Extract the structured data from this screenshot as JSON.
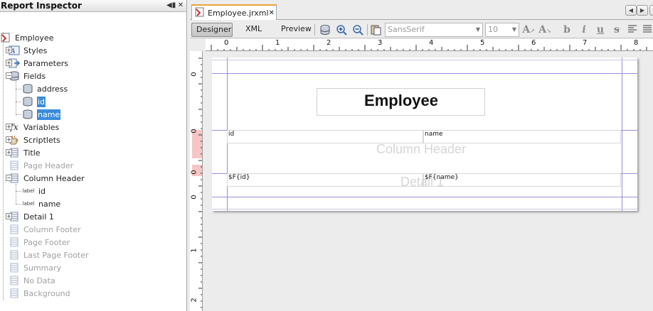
{
  "inspector": {
    "title": "Report Inspector",
    "tree": {
      "root": "Employee",
      "styles": "Styles",
      "parameters": "Parameters",
      "fields": "Fields",
      "field_items": [
        "address",
        "id",
        "name"
      ],
      "variables": "Variables",
      "scriptlets": "Scriptlets",
      "title": "Title",
      "page_header": "Page Header",
      "column_header": "Column Header",
      "column_header_items": [
        {
          "badge": "label",
          "name": "id"
        },
        {
          "badge": "label",
          "name": "name"
        }
      ],
      "detail": "Detail 1",
      "column_footer": "Column Footer",
      "page_footer": "Page Footer",
      "last_page_footer": "Last Page Footer",
      "summary": "Summary",
      "no_data": "No Data",
      "background": "Background"
    }
  },
  "editor": {
    "tab_label": "Employee.jrxml",
    "toolbar": {
      "designer": "Designer",
      "xml": "XML",
      "preview": "Preview",
      "font_name": "SansSerif",
      "font_size": "10"
    },
    "ruler_h": [
      "0",
      "1",
      "2",
      "3",
      "4",
      "5",
      "6",
      "7",
      "8"
    ],
    "ruler_v": [
      "0",
      "0",
      "0",
      "0",
      "1",
      "2"
    ],
    "report": {
      "title": "Employee",
      "col_header_id": "id",
      "col_header_name": "name",
      "band_column_header": "Column Header",
      "detail_id": "$F{id}",
      "detail_name": "$F{name}",
      "band_detail": "Detail 1"
    }
  },
  "colors": {
    "selection": "#3b8bdb",
    "guide": "#9a8ce0",
    "tab_accent": "#e8a33a"
  }
}
